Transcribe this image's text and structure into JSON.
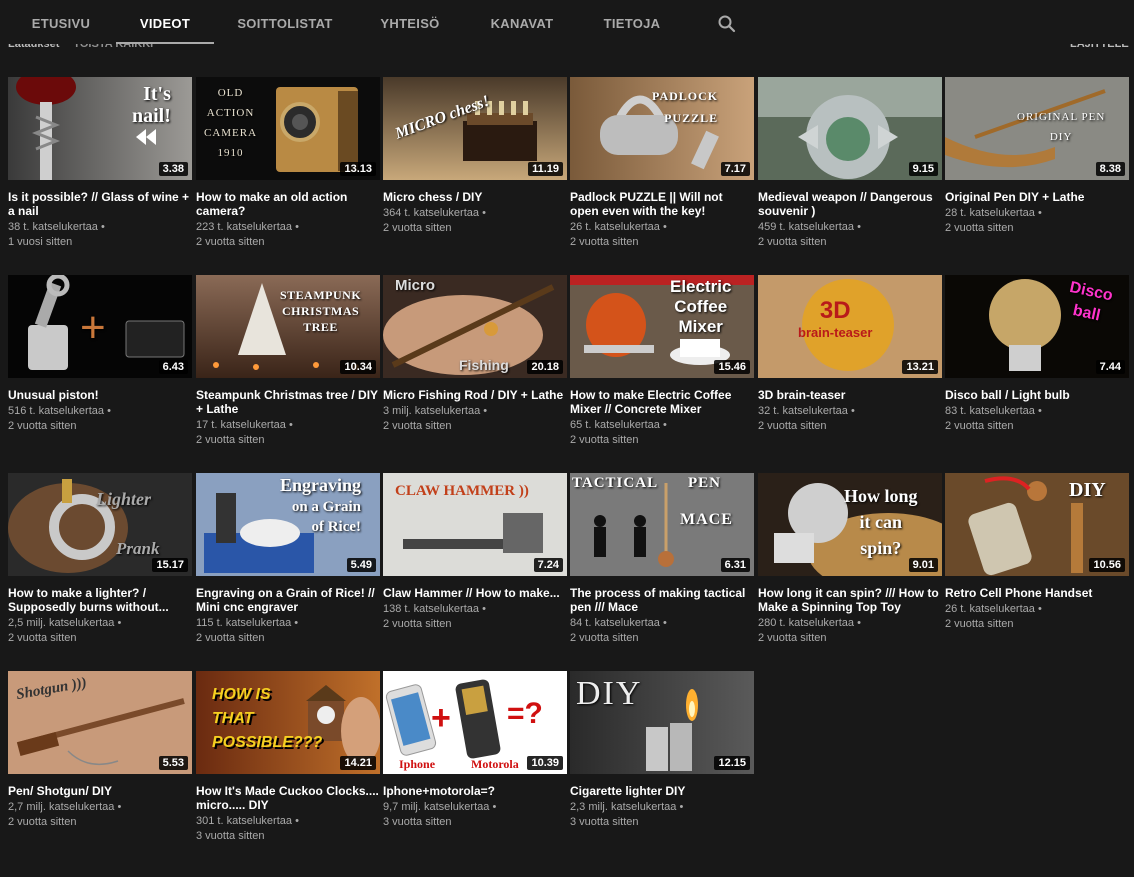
{
  "tabs": [
    {
      "label": "ETUSIVU",
      "active": false
    },
    {
      "label": "VIDEOT",
      "active": true
    },
    {
      "label": "SOITTOLISTAT",
      "active": false
    },
    {
      "label": "YHTEISÖ",
      "active": false
    },
    {
      "label": "KANAVAT",
      "active": false
    },
    {
      "label": "TIETOJA",
      "active": false
    }
  ],
  "search": {
    "icon": "search-icon"
  },
  "subbar": {
    "label": "Lataukset",
    "play_all": "TOISTA KAIKKI",
    "sort": "LAJITTELE"
  },
  "videos": [
    {
      "title": "Is it possible? // Glass of wine + a nail",
      "views": "38 t. katselukertaa",
      "age": "1 vuosi sitten",
      "duration": "3.38",
      "thumb_text": "It's nail!"
    },
    {
      "title": "How to make an old action camera?",
      "views": "223 t. katselukertaa",
      "age": "2 vuotta sitten",
      "duration": "13.13",
      "thumb_text": "OLD ACTION CAMERA 1910"
    },
    {
      "title": "Micro chess / DIY",
      "views": "364 t. katselukertaa",
      "age": "2 vuotta sitten",
      "duration": "11.19",
      "thumb_text": "MICRO chess!"
    },
    {
      "title": "Padlock PUZZLE || Will not open even with the key!",
      "views": "26 t. katselukertaa",
      "age": "2 vuotta sitten",
      "duration": "7.17",
      "thumb_text": "PADLOCK PUZZLE"
    },
    {
      "title": "Medieval weapon // Dangerous souvenir )",
      "views": "459 t. katselukertaa",
      "age": "2 vuotta sitten",
      "duration": "9.15",
      "thumb_text": ""
    },
    {
      "title": "Original Pen DIY + Lathe",
      "views": "28 t. katselukertaa",
      "age": "2 vuotta sitten",
      "duration": "8.38",
      "thumb_text": "ORIGINAL PEN DIY"
    },
    {
      "title": "Unusual piston!",
      "views": "516 t. katselukertaa",
      "age": "2 vuotta sitten",
      "duration": "6.43",
      "thumb_text": "+"
    },
    {
      "title": "Steampunk Christmas tree / DIY + Lathe",
      "views": "17 t. katselukertaa",
      "age": "2 vuotta sitten",
      "duration": "10.34",
      "thumb_text": "STEAMPUNK CHRISTMAS TREE"
    },
    {
      "title": "Micro Fishing Rod / DIY + Lathe",
      "views": "3 milj. katselukertaa",
      "age": "2 vuotta sitten",
      "duration": "20.18",
      "thumb_text": "Micro Fishing"
    },
    {
      "title": "How to make Electric Coffee Mixer // Concrete Mixer",
      "views": "65 t. katselukertaa",
      "age": "2 vuotta sitten",
      "duration": "15.46",
      "thumb_text": "Electric Coffee Mixer"
    },
    {
      "title": "3D brain-teaser",
      "views": "32 t. katselukertaa",
      "age": "2 vuotta sitten",
      "duration": "13.21",
      "thumb_text": "3D brain-teaser"
    },
    {
      "title": "Disco ball / Light bulb",
      "views": "83 t. katselukertaa",
      "age": "2 vuotta sitten",
      "duration": "7.44",
      "thumb_text": "Disco ball"
    },
    {
      "title": "How to make a lighter? / Supposedly burns without...",
      "views": "2,5 milj. katselukertaa",
      "age": "2 vuotta sitten",
      "duration": "15.17",
      "thumb_text": "Lighter Prank"
    },
    {
      "title": "Engraving on a Grain of Rice! // Mini cnc engraver",
      "views": "115 t. katselukertaa",
      "age": "2 vuotta sitten",
      "duration": "5.49",
      "thumb_text": "Engraving on a Grain of Rice!"
    },
    {
      "title": "Claw Hammer // How to make...",
      "views": "138 t. katselukertaa",
      "age": "2 vuotta sitten",
      "duration": "7.24",
      "thumb_text": "CLAW HAMMER ))"
    },
    {
      "title": "The process of making tactical pen /// Mace",
      "views": "84 t. katselukertaa",
      "age": "2 vuotta sitten",
      "duration": "6.31",
      "thumb_text": "TACTICAL PEN MACE"
    },
    {
      "title": "How long it can spin? /// How to Make a Spinning Top Toy",
      "views": "280 t. katselukertaa",
      "age": "2 vuotta sitten",
      "duration": "9.01",
      "thumb_text": "How long it can spin?"
    },
    {
      "title": "Retro Cell Phone Handset",
      "views": "26 t. katselukertaa",
      "age": "2 vuotta sitten",
      "duration": "10.56",
      "thumb_text": "DIY"
    },
    {
      "title": "Pen/ Shotgun/ DIY",
      "views": "2,7 milj. katselukertaa",
      "age": "2 vuotta sitten",
      "duration": "5.53",
      "thumb_text": "Shotgun )))"
    },
    {
      "title": "How It's Made Cuckoo Clocks.... micro..... DIY",
      "views": "301 t. katselukertaa",
      "age": "3 vuotta sitten",
      "duration": "14.21",
      "thumb_text": "HOW IS THAT POSSIBLE???"
    },
    {
      "title": "Iphone+motorola=?",
      "views": "9,7 milj. katselukertaa",
      "age": "3 vuotta sitten",
      "duration": "10.39",
      "thumb_text": "Iphone Motorola"
    },
    {
      "title": "Cigarette lighter DIY",
      "views": "2,3 milj. katselukertaa",
      "age": "3 vuotta sitten",
      "duration": "12.15",
      "thumb_text": "DIY"
    }
  ],
  "colors": {
    "background": "#181818",
    "text": "#ffffff",
    "muted": "#aaaaaa"
  }
}
